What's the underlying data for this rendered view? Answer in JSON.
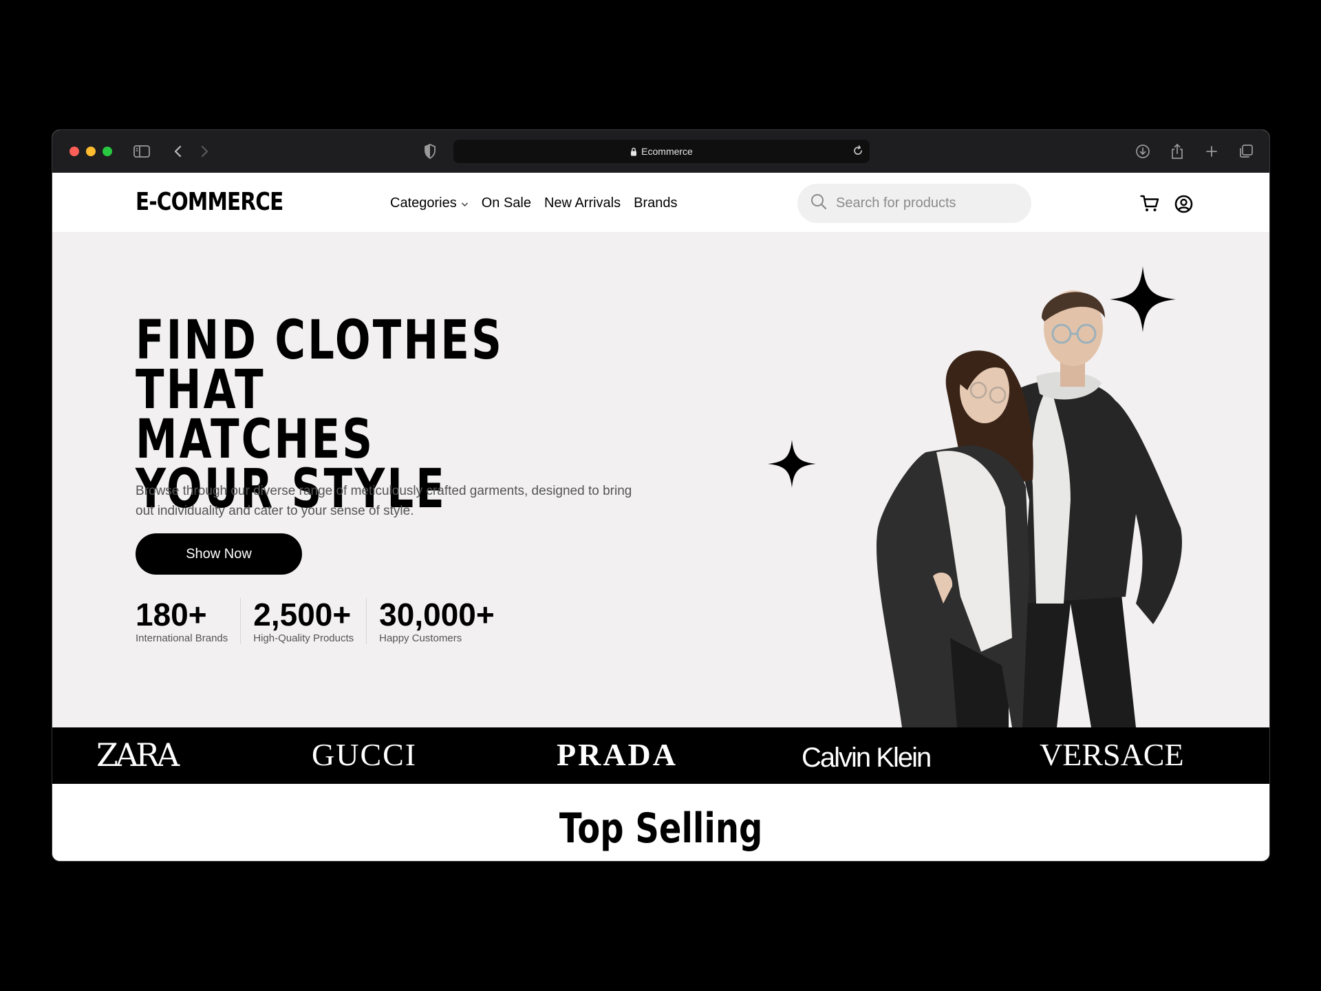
{
  "browser": {
    "url_title": "Ecommerce"
  },
  "nav": {
    "logo": "E-COMMERCE",
    "menu": [
      {
        "label": "Categories"
      },
      {
        "label": "On Sale"
      },
      {
        "label": "New Arrivals"
      },
      {
        "label": "Brands"
      }
    ],
    "search_placeholder": "Search for products"
  },
  "hero": {
    "title_lines": [
      "FIND CLOTHES",
      "THAT MATCHES",
      "YOUR STYLE"
    ],
    "description": "Browse through our diverse range of meticulously crafted garments, designed to bring out individuality and cater to your sense of style.",
    "cta_label": "Show Now",
    "stats": [
      {
        "value": "180+",
        "label": "International Brands"
      },
      {
        "value": "2,500+",
        "label": "High-Quality Products"
      },
      {
        "value": "30,000+",
        "label": "Happy Customers"
      }
    ]
  },
  "brands": [
    "ZARA",
    "GUCCI",
    "PRADA",
    "Calvin Klein",
    "VERSACE"
  ],
  "sections": {
    "top_selling": "Top Selling"
  },
  "colors": {
    "hero_bg": "#f2f0f1",
    "brand_strip_bg": "#000000",
    "cta_bg": "#000000"
  }
}
